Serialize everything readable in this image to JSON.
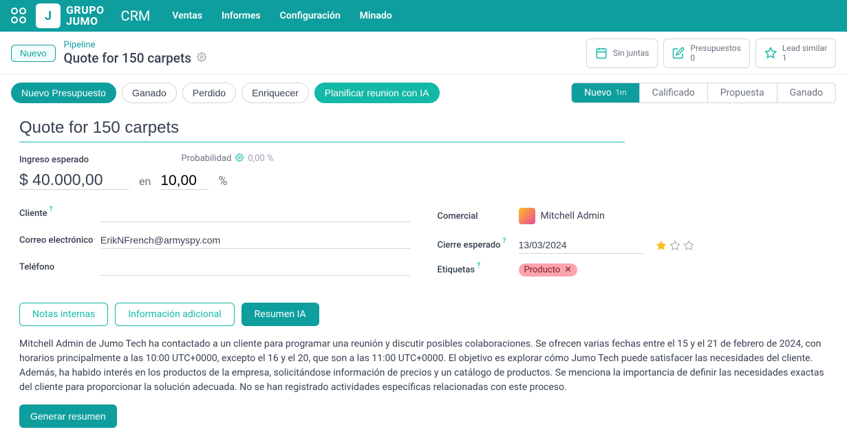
{
  "nav": {
    "logo_text": "GRUPO\nJUMO",
    "app": "CRM",
    "items": [
      "Ventas",
      "Informes",
      "Configuración",
      "Minado"
    ]
  },
  "control": {
    "new": "Nuevo",
    "breadcrumb_link": "Pipeline",
    "title": "Quote for 150 carpets",
    "stats": {
      "meetings": {
        "label": "Sin juntas"
      },
      "quotes": {
        "label": "Presupuestos",
        "count": "0"
      },
      "similar": {
        "label": "Lead similar",
        "count": "1"
      }
    }
  },
  "actions": {
    "new_quote": "Nuevo Presupuesto",
    "won": "Ganado",
    "lost": "Perdido",
    "enrich": "Enriquecer",
    "plan_ai": "Planificar reunion con IA"
  },
  "stages": [
    {
      "label": "Nuevo",
      "duration": "1m",
      "active": true
    },
    {
      "label": "Calificado"
    },
    {
      "label": "Propuesta"
    },
    {
      "label": "Ganado"
    }
  ],
  "form": {
    "title": "Quote for 150 carpets",
    "revenue_label": "Ingreso esperado",
    "revenue": "$ 40.000,00",
    "en": "en",
    "prob_label": "Probabilidad",
    "prob_auto": "0,00 %",
    "prob": "10,00",
    "pct": "%",
    "left": {
      "customer": "Cliente",
      "email_label": "Correo electrónico",
      "email": "ErikNFrench@armyspy.com",
      "phone": "Teléfono"
    },
    "right": {
      "salesperson_label": "Comercial",
      "salesperson": "Mitchell Admin",
      "close_label": "Cierre esperado",
      "close": "13/03/2024",
      "tags_label": "Etiquetas",
      "tag": "Producto"
    }
  },
  "tabs": {
    "notes": "Notas internas",
    "extra": "Información adicional",
    "ai": "Resumen IA"
  },
  "summary": "Mitchell Admin de Jumo Tech ha contactado a un cliente para programar una reunión y discutir posibles colaboraciones. Se ofrecen varias fechas entre el 15 y el 21 de febrero de 2024, con horarios principalmente a las 10:00 UTC+0000, excepto el 16 y el 20, que son a las 11:00 UTC+0000. El objetivo es explorar cómo Jumo Tech puede satisfacer las necesidades del cliente. Además, ha habido interés en los productos de la empresa, solicitándose información de precios y un catálogo de productos. Se menciona la importancia de definir las necesidades exactas del cliente para proporcionar la solución adecuada. No se han registrado actividades específicas relacionadas con este proceso.",
  "generate": "Generar resumen"
}
